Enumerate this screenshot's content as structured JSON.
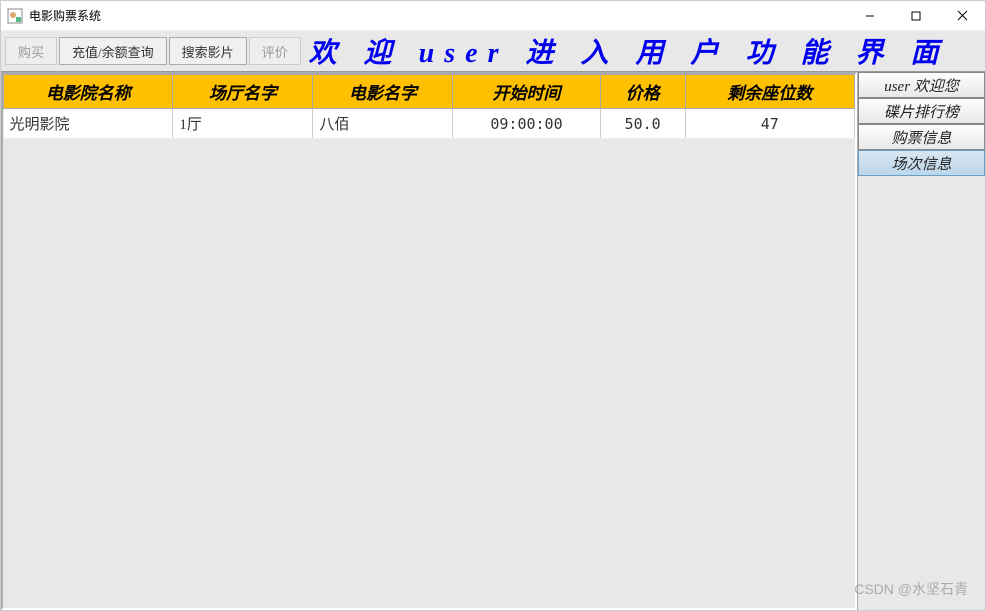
{
  "window": {
    "title": "电影购票系统"
  },
  "toolbar": {
    "buy": "购买",
    "recharge": "充值/余额查询",
    "search": "搜索影片",
    "review": "评价"
  },
  "banner": {
    "text": "欢 迎 user 进 入 用 户 功 能 界 面"
  },
  "table": {
    "headers": {
      "cinema": "电影院名称",
      "hall": "场厅名字",
      "movie": "电影名字",
      "start": "开始时间",
      "price": "价格",
      "seats": "剩余座位数"
    },
    "rows": [
      {
        "cinema": "光明影院",
        "hall": "1厅",
        "movie": "八佰",
        "start": "09:00:00",
        "price": "50.0",
        "seats": "47"
      }
    ]
  },
  "sidebar": {
    "welcome": "user 欢迎您",
    "ranking": "碟片排行榜",
    "tickets": "购票信息",
    "sessions": "场次信息"
  },
  "watermark": "CSDN @水坚石青"
}
